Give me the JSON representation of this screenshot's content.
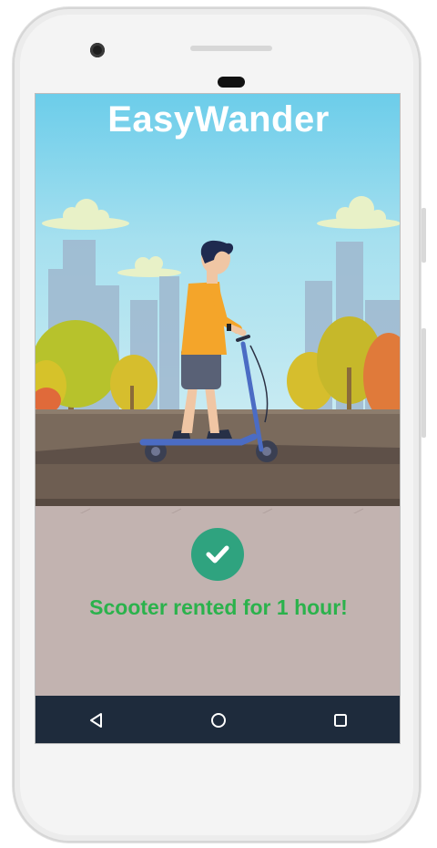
{
  "app": {
    "title": "EasyWander"
  },
  "status": {
    "message": "Scooter rented for 1 hour!",
    "icon": "checkmark-circle-icon",
    "color": "#2bb24c"
  },
  "navbar": {
    "buttons": [
      {
        "name": "back",
        "icon": "back-triangle-icon"
      },
      {
        "name": "home",
        "icon": "home-circle-icon"
      },
      {
        "name": "recents",
        "icon": "recents-square-icon"
      }
    ]
  },
  "colors": {
    "sky": "#6ccdea",
    "ground": "#c2b3b0",
    "navbar": "#1e2b3c",
    "check_badge": "#2fa37f"
  }
}
